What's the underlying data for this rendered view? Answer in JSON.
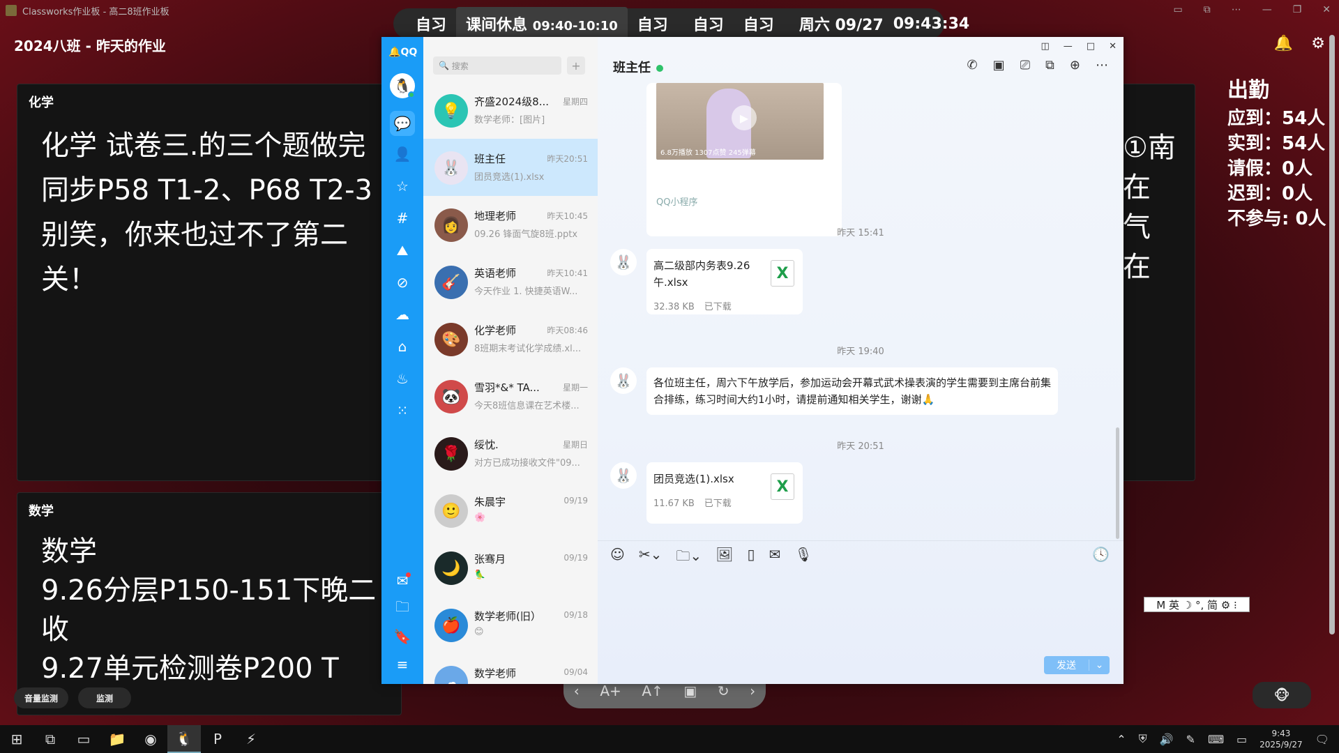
{
  "background_app": {
    "window_title": "Classworks作业板 - 高二8班作业板",
    "header_title": "2024八班 - 昨天的作业",
    "cards": [
      {
        "title": "化学",
        "lines": [
          "化学 试卷三.的三个题做完",
          "同步P58 T1-2、P68 T2-3",
          "别笑，你来也过不了第二",
          "关！"
        ]
      },
      {
        "title": "数学",
        "lines": [
          "数学",
          "9.26分层P150-151下晚二",
          "收",
          "9.27单元检测卷P200 T"
        ]
      }
    ],
    "right_fragments": [
      "①南",
      "在",
      "气",
      "在"
    ],
    "attendance": {
      "title": "出勤",
      "items": [
        "应到：54人",
        "实到：54人",
        "请假：0人",
        "迟到：0人",
        "不参与: 0人"
      ]
    },
    "floating_buttons": {
      "volume_monitor": "音量监测",
      "monitor": "监测"
    },
    "ime_bar": "M 英 ☽ °, 简 ⚙ ⁝"
  },
  "schedule_bar": {
    "segments": [
      "自习",
      "课间休息",
      "自习",
      "自习",
      "自习"
    ],
    "active_time": "09:40-10:10",
    "date": "周六 09/27",
    "clock": "09:43:34"
  },
  "qq": {
    "logo": "QQ",
    "search_placeholder": "搜索",
    "conversations": [
      {
        "name": "齐盛2024级8...",
        "time": "星期四",
        "preview": "数学老师：[图片]",
        "color": "#2bc5b4",
        "glyph": "💡"
      },
      {
        "name": "班主任",
        "time": "昨天20:51",
        "preview": "团员竞选(1).xlsx",
        "color": "#e9e4f2",
        "glyph": "🐰"
      },
      {
        "name": "地理老师",
        "time": "昨天10:45",
        "preview": "09.26 锋面气旋8班.pptx",
        "color": "#8a5a4a",
        "glyph": "👩"
      },
      {
        "name": "英语老师",
        "time": "昨天10:41",
        "preview": "今天作业 1. 快捷英语W...",
        "color": "#3a6fb0",
        "glyph": "🎸"
      },
      {
        "name": "化学老师",
        "time": "昨天08:46",
        "preview": "8班期末考试化学成绩.xl...",
        "color": "#7a3a2a",
        "glyph": "🎨"
      },
      {
        "name": "雪羽*&* TA...",
        "time": "星期一",
        "preview": "今天8班信息课在艺术楼...",
        "color": "#d04a4a",
        "glyph": "🐼"
      },
      {
        "name": "绥忱.",
        "time": "星期日",
        "preview": "对方已成功接收文件\"09...",
        "color": "#2a1a1a",
        "glyph": "🌹"
      },
      {
        "name": "朱晨宇",
        "time": "09/19",
        "preview": "🌸",
        "color": "#cccccc",
        "glyph": "🙂"
      },
      {
        "name": "张骞月",
        "time": "09/19",
        "preview": "🦜",
        "color": "#1a2a2a",
        "glyph": "🌙"
      },
      {
        "name": "数学老师(旧）",
        "time": "09/18",
        "preview": "😊",
        "color": "#2a8ad8",
        "glyph": "🍎"
      },
      {
        "name": "数学老师",
        "time": "09/04",
        "preview": "",
        "color": "#6aa8e8",
        "glyph": "☁"
      }
    ],
    "chat": {
      "title": "班主任",
      "mini_program": {
        "stats": "6.8万播放 1307点赞 245弹幕",
        "label": "QQ小程序"
      },
      "messages": [
        {
          "time": "昨天 15:41",
          "file_name": "高二级部内务表9.26午.xlsx",
          "size": "32.38 KB",
          "status": "已下载"
        },
        {
          "time": "昨天 19:40",
          "text": "各位班主任，周六下午放学后，参加运动会开幕式武术操表演的学生需要到主席台前集合排练，练习时间大约1小时，请提前通知相关学生，谢谢🙏"
        },
        {
          "time": "昨天 20:51",
          "file_name": "团员竞选(1).xlsx",
          "size": "11.67 KB",
          "status": "已下载"
        }
      ],
      "send_label": "发送"
    }
  },
  "taskbar": {
    "time": "9:43",
    "date": "2025/9/27"
  },
  "colors": {
    "qq_blue": "#1a9cf7",
    "selected": "#cde8fd",
    "excel_green": "#1e9e4a"
  }
}
